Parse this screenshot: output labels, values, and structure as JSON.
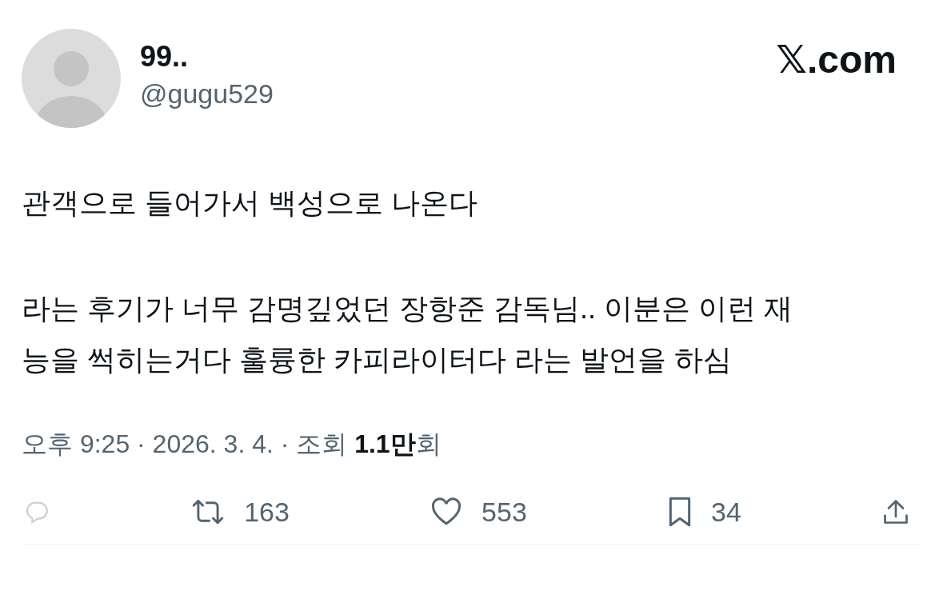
{
  "author": {
    "name": "99..",
    "handle": "@gugu529"
  },
  "site": "𝕏.com",
  "paragraphs": [
    {
      "lines": [
        "관객으로 들어가서 백성으로 나온다"
      ]
    },
    {
      "lines": [
        "라는 후기가 너무 감명깊었던 장항준 감독님.. 이분은 이런 재",
        "능을 썩히는거다 훌륭한 카피라이터다 라는 발언을 하심"
      ]
    }
  ],
  "meta": "오후 9:25 · 2026. 3. 4. · 조회 **1.1만**회",
  "actions": [
    {
      "kind": "reply"
    },
    {
      "kind": "repost",
      "count": "163"
    },
    {
      "kind": "like",
      "count": "553"
    },
    {
      "kind": "bookmark",
      "count": "34"
    },
    {
      "kind": "share"
    }
  ]
}
